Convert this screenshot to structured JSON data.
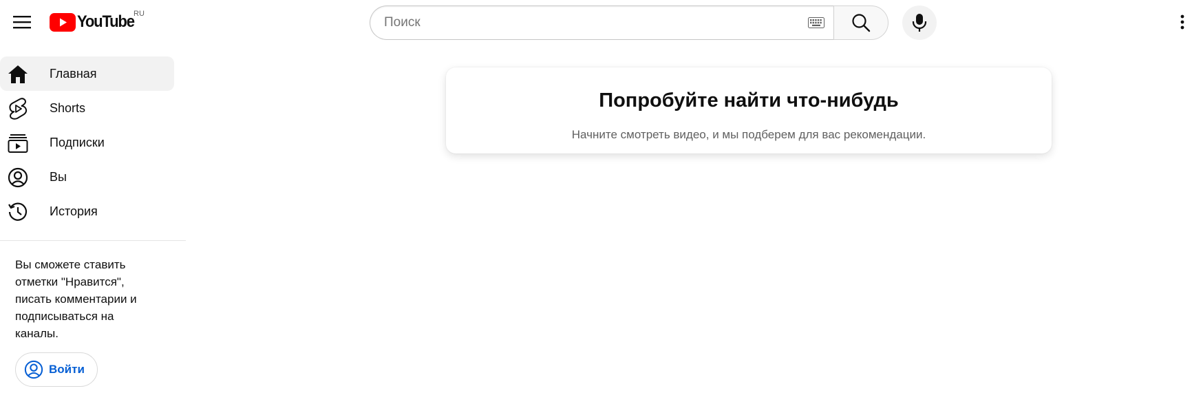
{
  "header": {
    "logo_text": "YouTube",
    "country_code": "RU",
    "search_placeholder": "Поиск",
    "icons": {
      "menu": "hamburger-menu-icon",
      "logo": "youtube-play-logo-icon",
      "keyboard": "keyboard-icon",
      "search": "search-icon",
      "mic": "microphone-icon",
      "more": "more-vertical-icon"
    }
  },
  "sidebar": {
    "items": [
      {
        "label": "Главная",
        "icon": "home-icon",
        "active": true
      },
      {
        "label": "Shorts",
        "icon": "shorts-icon",
        "active": false
      },
      {
        "label": "Подписки",
        "icon": "subscriptions-icon",
        "active": false
      },
      {
        "label": "Вы",
        "icon": "account-circle-icon",
        "active": false
      },
      {
        "label": "История",
        "icon": "history-icon",
        "active": false
      }
    ],
    "signin_prompt": "Вы сможете ставить отметки \"Нравится\", писать комментарии и подписываться на каналы.",
    "signin_button": "Войти"
  },
  "main": {
    "title": "Попробуйте найти что-нибудь",
    "subtitle": "Начните смотреть видео, и мы подберем для вас рекомендации."
  },
  "colors": {
    "brand_red": "#ff0000",
    "link_blue": "#065fd4",
    "active_bg": "#f2f2f2"
  }
}
